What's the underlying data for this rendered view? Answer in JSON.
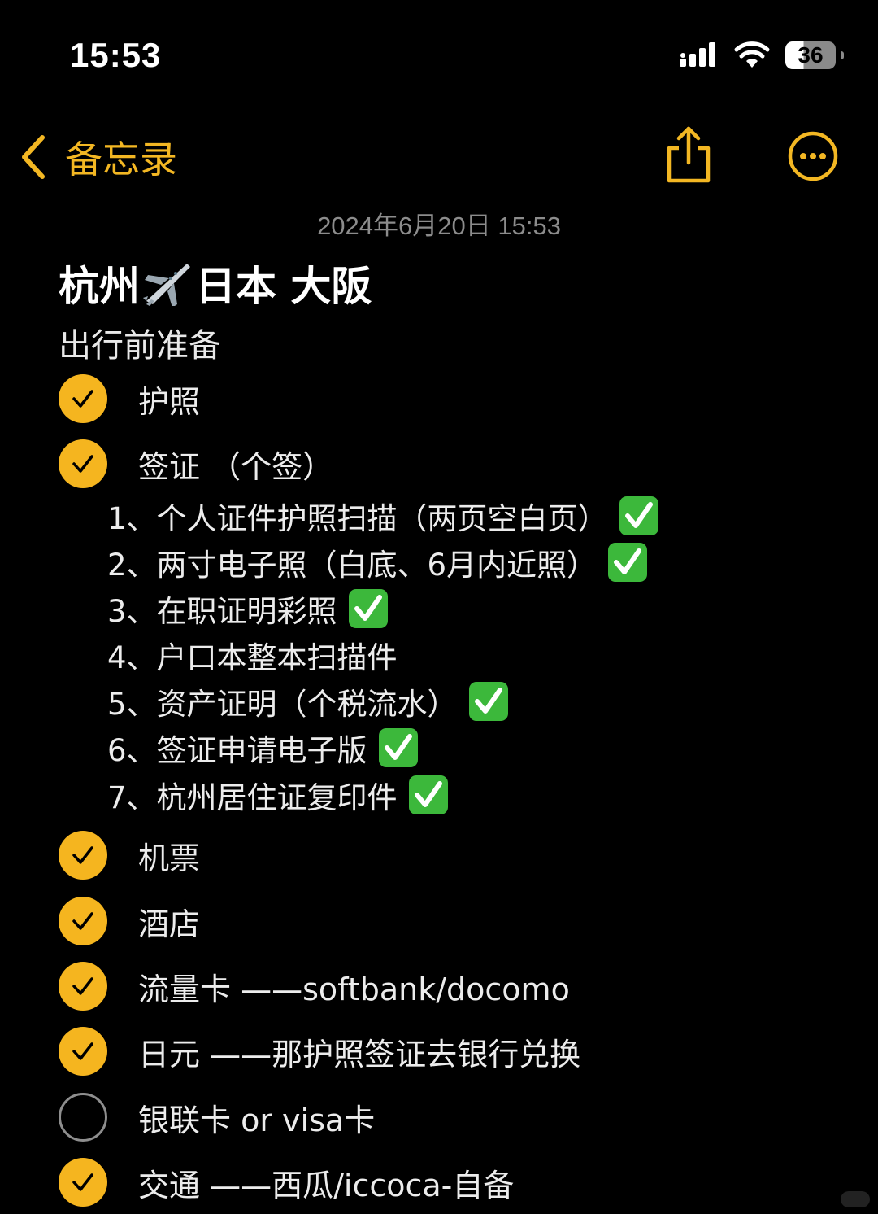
{
  "status_bar": {
    "time": "15:53",
    "battery": "36"
  },
  "nav": {
    "back_label": "备忘录"
  },
  "note": {
    "date": "2024年6月20日 15:53",
    "title_left": "杭州",
    "title_right": "日本 大阪",
    "subtitle": "出行前准备"
  },
  "checklist": [
    {
      "label": "护照",
      "done": true
    },
    {
      "label": "签证 （个签）",
      "done": true
    },
    {
      "label": "机票",
      "done": true
    },
    {
      "label": "酒店",
      "done": true
    },
    {
      "label": "流量卡 ——softbank/docomo",
      "done": true
    },
    {
      "label": "日元 ——那护照签证去银行兑换",
      "done": true
    },
    {
      "label": "银联卡 or visa卡",
      "done": false
    },
    {
      "label": "交通 ——西瓜/iccoca-自备",
      "done": true
    }
  ],
  "visa_steps": [
    {
      "text": "1、个人证件护照扫描（两页空白页）",
      "checked": true
    },
    {
      "text": "2、两寸电子照（白底、6月内近照）",
      "checked": true
    },
    {
      "text": "3、在职证明彩照",
      "checked": true
    },
    {
      "text": "4、户口本整本扫描件",
      "checked": false
    },
    {
      "text": "5、资产证明（个税流水）",
      "checked": true
    },
    {
      "text": "6、签证申请电子版",
      "checked": true
    },
    {
      "text": "7、杭州居住证复印件",
      "checked": true
    }
  ],
  "colors": {
    "accent": "#f5b51f",
    "background": "#000000",
    "date_gray": "#8c8c8c",
    "emoji_green": "#3cb83b"
  },
  "icons": {
    "back": "chevron-left-icon",
    "share": "share-icon",
    "more": "ellipsis-circle-icon",
    "plane": "airplane-emoji",
    "check": "checkmark-icon"
  }
}
